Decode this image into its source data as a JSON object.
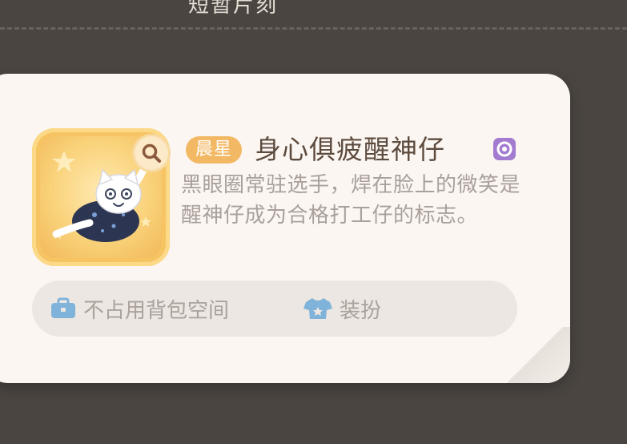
{
  "header": {
    "title": "短暂片刻"
  },
  "item": {
    "rarity": "晨星",
    "name": "身心俱疲醒神仔",
    "description": "黑眼圈常驻选手，焊在脸上的微笑是醒神仔成为合格打工仔的标志。",
    "attributes": [
      {
        "icon": "briefcase-icon",
        "label": "不占用背包空间"
      },
      {
        "icon": "shirt-icon",
        "label": "装扮"
      }
    ]
  },
  "colors": {
    "background": "#4a4541",
    "card": "#fcf6f2",
    "rarity_badge": "#f2b864",
    "item_frame": "#f6c463",
    "name_text": "#5d4b3e",
    "desc_text": "#a9a09a",
    "attribute_icon": "#7fb3d9",
    "type_icon": "#a37bd0"
  }
}
